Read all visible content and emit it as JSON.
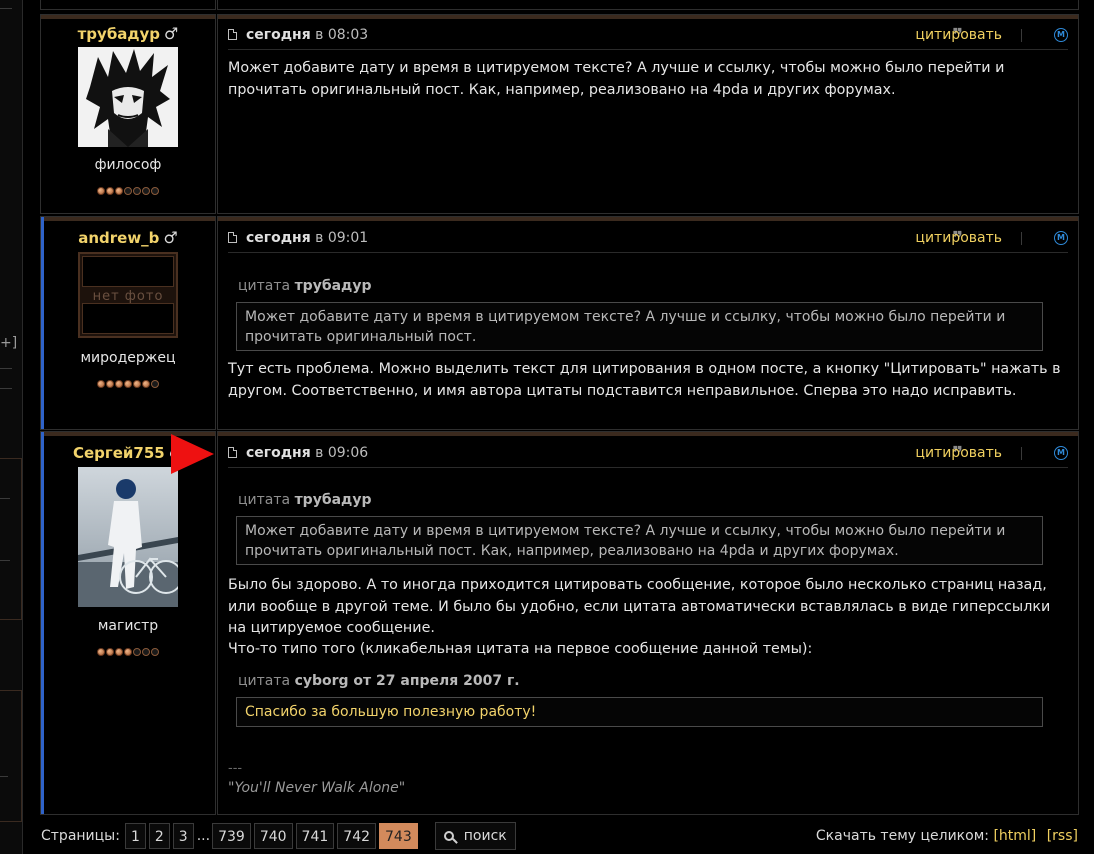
{
  "left_sidebar": {
    "plus_label": "+]"
  },
  "posts": [
    {
      "author": "трубадур",
      "gender_symbol": "♂",
      "avatar": "anime-manga-avatar",
      "rank": "философ",
      "rating": 3,
      "rating_max": 7,
      "date_word": "сегодня",
      "time": "в 08:03",
      "quote_label": "цитировать",
      "text": "Может добавите дату и время в цитируемом тексте? А лучше и ссылку, чтобы можно было перейти и прочитать оригинальный пост. Как, например, реализовано на 4pda и других форумах."
    },
    {
      "author": "andrew_b",
      "gender_symbol": "♂",
      "avatar_placeholder": "нет фото",
      "rank": "миродержец",
      "rating": 6,
      "rating_max": 7,
      "date_word": "сегодня",
      "time": "в 09:01",
      "quote_label": "цитировать",
      "quote_prefix": "цитата",
      "quote_author": "трубадур",
      "quote_text": "Может добавите дату и время в цитируемом тексте? А лучше и ссылку, чтобы можно было перейти и прочитать оригинальный пост.",
      "text": "Тут есть проблема. Можно выделить текст для цитирования в одном посте, а кнопку \"Цитировать\" нажать в другом. Соответственно, и имя автора цитаты подставится неправильное. Сперва это надо исправить."
    },
    {
      "author": "Сергей755",
      "gender_symbol": "♂",
      "avatar": "person-with-bicycle-photo",
      "rank": "магистр",
      "rating": 4,
      "rating_max": 7,
      "date_word": "сегодня",
      "time": "в 09:06",
      "quote_label": "цитировать",
      "quote_prefix": "цитата",
      "quote_author": "трубадур",
      "quote_text": "Может добавите дату и время в цитируемом тексте? А лучше и ссылку, чтобы можно было перейти и прочитать оригинальный пост. Как, например, реализовано на 4pda и других форумах.",
      "text": "Было бы здорово. А то иногда приходится цитировать сообщение, которое было несколько страниц назад, или вообще в другой теме. И было бы удобно, если цитата автоматически вставлялась в виде гиперссылки на цитируемое сообщение.",
      "text2": "Что-то типо того (кликабельная цитата на первое сообщение данной темы):",
      "quote2_prefix": "цитата",
      "quote2_author": "cyborg от 27 апреля 2007 г.",
      "quote2_text": "Спасибо за большую полезную работу!",
      "signature_sep": "---",
      "signature": "\"You'll Never Walk Alone\""
    }
  ],
  "pagination": {
    "label": "Страницы:",
    "pages": [
      "1",
      "2",
      "3",
      "739",
      "740",
      "741",
      "742",
      "743"
    ],
    "ellipsis": "...",
    "current": "743",
    "search_label": "поиск"
  },
  "download": {
    "label": "Скачать тему целиком:",
    "html": "[html]",
    "rss": "[rss]"
  },
  "colors": {
    "username": "#f2d36b",
    "link": "#f0d060",
    "current_page": "#d28a5c",
    "accent_bar": "#2f63c9",
    "arrow": "#ee1111"
  }
}
